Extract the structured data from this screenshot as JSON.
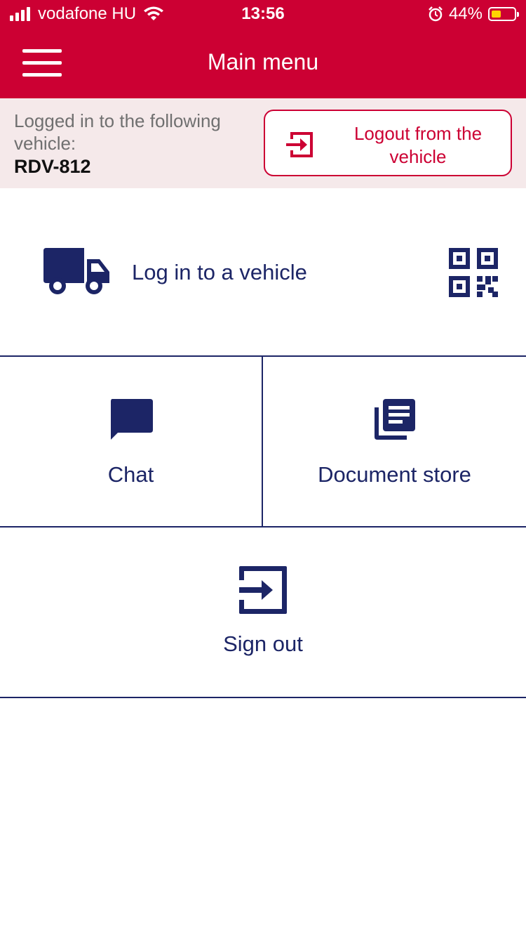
{
  "status_bar": {
    "carrier": "vodafone HU",
    "time": "13:56",
    "battery": "44%",
    "icons": [
      "signal-icon",
      "wifi-icon",
      "alarm-icon",
      "battery-icon"
    ]
  },
  "header": {
    "title": "Main menu",
    "menu_icon": "hamburger-menu-icon",
    "color": "#cc0033"
  },
  "vehicle_bar": {
    "label": "Logged in to the following vehicle:",
    "plate": "RDV-812",
    "logout_button": "Logout from the vehicle",
    "logout_icon": "logout-arrow-icon"
  },
  "menu": {
    "login_vehicle": {
      "label": "Log in to a vehicle",
      "icon": "truck-icon",
      "qr_icon": "qr-code-icon"
    },
    "chat": {
      "label": "Chat",
      "icon": "chat-bubble-icon"
    },
    "documents": {
      "label": "Document store",
      "icon": "documents-icon"
    },
    "sign_out": {
      "label": "Sign out",
      "icon": "sign-out-icon"
    }
  },
  "colors": {
    "brand_red": "#cc0033",
    "navy": "#1c2566",
    "vehicle_bar_bg": "#f5e9ea"
  }
}
